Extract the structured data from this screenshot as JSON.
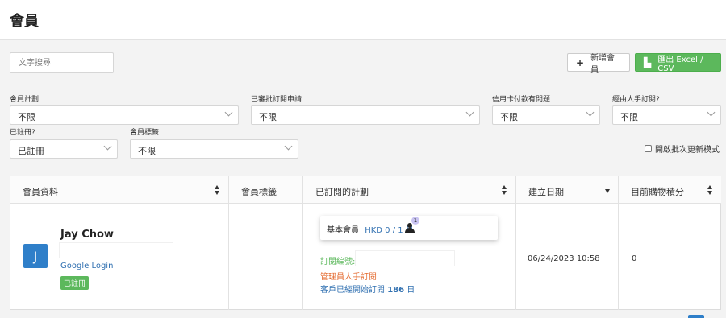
{
  "header": {
    "title": "會員"
  },
  "search": {
    "placeholder": "文字搜尋"
  },
  "toolbar": {
    "add_label": "新增會員",
    "export_label": "匯出 Excel / CSV"
  },
  "filters": {
    "plan": {
      "label": "會員計劃",
      "value": "不限"
    },
    "approved": {
      "label": "已審批訂閱申請",
      "value": "不限"
    },
    "card_issue": {
      "label": "信用卡付款有問題",
      "value": "不限"
    },
    "manual": {
      "label": "經由人手訂閱?",
      "value": "不限"
    },
    "registered": {
      "label": "已註冊?",
      "value": "已註冊"
    },
    "tag": {
      "label": "會員標籤",
      "value": "不限"
    }
  },
  "batch_mode": {
    "label": "開啟批次更新模式",
    "checked": false
  },
  "table": {
    "columns": [
      "會員資料",
      "會員標籤",
      "已訂閱的計劃",
      "建立日期",
      "目前購物積分"
    ],
    "rows": [
      {
        "avatar_letter": "J",
        "name": "Jay Chow",
        "login": "Google Login",
        "status": "已註冊",
        "tag": "",
        "plan_name": "基本會員",
        "plan_price": "HKD 0 / 1 月",
        "plan_count": "1",
        "subscription_label": "訂閱編號:",
        "manual_label": "管理員人手訂閱",
        "started_prefix": "客戶已經開始訂閱",
        "started_days": "186",
        "started_suffix": "日",
        "created": "06/24/2023 10:58",
        "points": "0"
      }
    ]
  }
}
